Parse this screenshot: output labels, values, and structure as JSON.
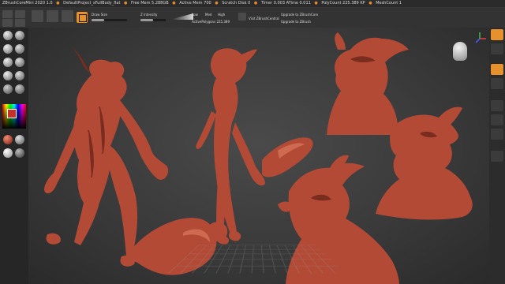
{
  "title_bar": {
    "app": "ZBrushCoreMini 2020 1.0",
    "items": [
      "DefaultProject_sFullBody_flat",
      "Free Mem 5.288GB",
      "Active Mem 700",
      "Scratch Disk 0",
      "Timer 0.003 ATime 0.011",
      "PolyCount 225.389 KP",
      "MeshCount 1"
    ]
  },
  "toolbar": {
    "draw_size_label": "Draw Size",
    "z_intensity_label": "Z Intensity",
    "levels": [
      "Low",
      "Med",
      "High"
    ],
    "active_points_label": "ActivePolygons 225,389",
    "visit_label": "Visit ZBrushCentral",
    "upgrade_core": "Upgrade to ZBrushCore",
    "upgrade_zbrush": "Upgrade to ZBrush",
    "draw_size_value": 0.35,
    "z_intensity_value": 0.5
  },
  "colors": {
    "accent": "#e7912d",
    "clay": "#b24a36",
    "active_color": "#c6302c"
  },
  "left_shelf": {
    "brushes": [
      "standard-brush",
      "move-brush",
      "clay-brush",
      "smooth-brush",
      "inflate-brush",
      "pinch-brush",
      "dam-standard-brush",
      "trim-brush"
    ],
    "materials": [
      "red-wax-material",
      "white-material",
      "clay-material"
    ]
  },
  "right_panel": {
    "buttons": [
      "frame-icon",
      "move-icon",
      "scale-icon",
      "rotate-icon",
      "perspective-icon",
      "floor-icon",
      "polyframe-icon",
      "transp-icon"
    ]
  }
}
